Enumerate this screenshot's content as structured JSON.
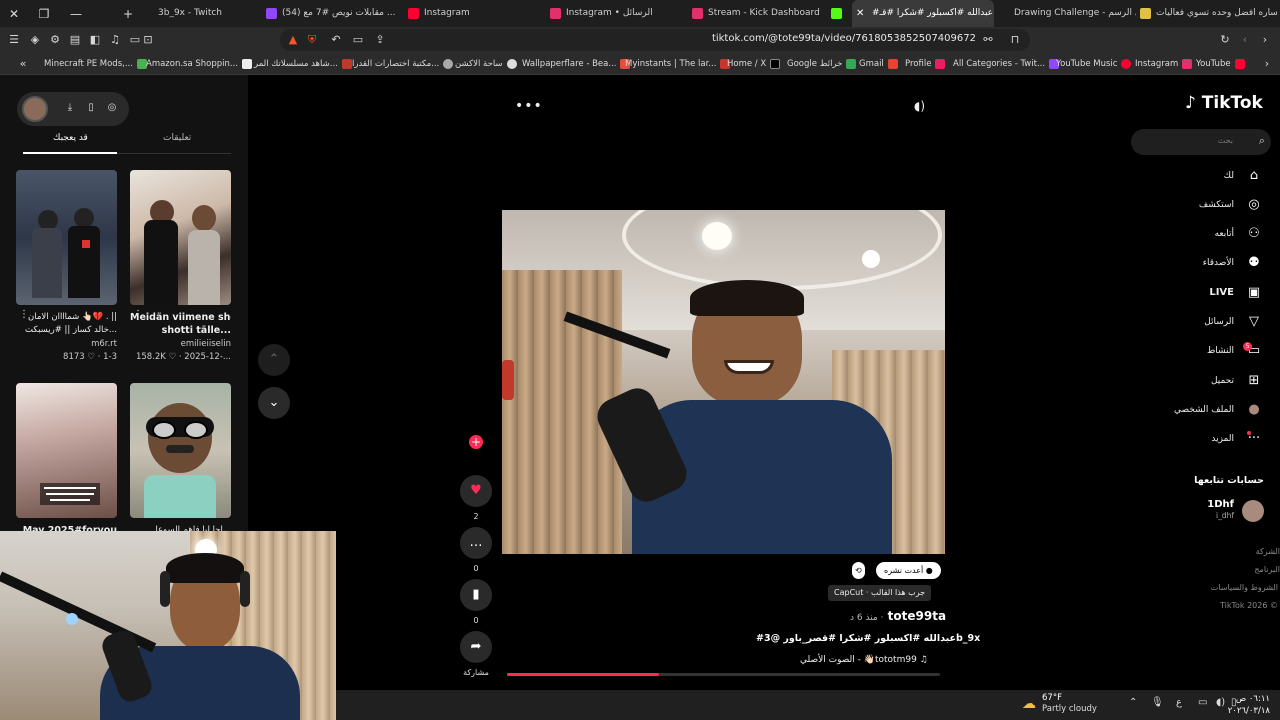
{
  "browser": {
    "tabs": [
      {
        "label": "3b_9x - Twitch",
        "color": "#9146ff"
      },
      {
        "label": "(54) مقابلات نويص #7 مع ...",
        "color": "#9146ff"
      },
      {
        "label": "Instagram",
        "color": "#ff0033"
      },
      {
        "label": "Instagram • الرسائل",
        "color": "#e1306c"
      },
      {
        "label": "Stream - Kick Dashboard",
        "color": "#e1306c"
      },
      {
        "label": "#عبدالله #اكسبلور #شكرا #قـ",
        "color": "#53fc18"
      },
      {
        "label": "Drawing Challenge - تحدي الرسم",
        "color": "#ffffff"
      },
      {
        "label": "ساره افضل وحده تسوي فعاليات",
        "color": "#e0c040"
      }
    ],
    "url": "tiktok.com/@tote99ta/video/7618053852507409672",
    "bookmarks": [
      "Minecraft PE Mods,...",
      "Amazon.sa Shoppin...",
      "شاهد مسلسلاتك المر...",
      "مكتبة اختصارات القدرا...",
      "ساحة الاكشن",
      "Wallpaperflare - Bea...",
      "Myinstants | The lar...",
      "Home / X",
      "Google خرائط",
      "Gmail",
      "Profile",
      "All Categories - Twit...",
      "YouTube Music",
      "Instagram",
      "YouTube"
    ]
  },
  "left_panel": {
    "tabs": {
      "liked": "قد يعجبك",
      "comments": "تعليقات"
    },
    "cards": [
      {
        "title": "Meidän viimene shotti tälle",
        "title2": "shotti tälle...",
        "author": "emilieiiselin",
        "meta": "158.2K ♡ · 2025-12-...",
        "bold": true
      },
      {
        "title": "شماااان الامان 👆🏻💔 . ||",
        "title2": "خالد كساز || #ريسبكت...",
        "author": "m6r.rt",
        "meta": "8173 ♡ · 1-3",
        "bold": false
      },
      {
        "title": "احا ليا فاهم السوعا...",
        "title2": "",
        "author": "",
        "meta": "",
        "bold": false
      },
      {
        "title": "May 2025#foryou",
        "title2": "",
        "author": "",
        "meta": "",
        "bold": true
      }
    ]
  },
  "video": {
    "likes": "2",
    "comments": "0",
    "saves": "0",
    "share_label": "مشاركة",
    "repost_chip": "أعدت نشره",
    "capcut_chip": "CapCut · جرب هذا القالب",
    "author": "tote99ta",
    "ago": "منذ 6 د ·",
    "description": "#عبدالله #اكسبلور #شكرا #قصر_باور @3b_9x",
    "music": "الصوت الأصلي - 👋🏻tototm99",
    "progress": 0.35
  },
  "right_nav": {
    "logo": "TikTok",
    "search_placeholder": "بحث",
    "items": [
      {
        "label": "لك",
        "icon": "⌂"
      },
      {
        "label": "استكشف",
        "icon": "◎"
      },
      {
        "label": "أتابعه",
        "icon": "⚇"
      },
      {
        "label": "الأصدقاء",
        "icon": "⚇"
      },
      {
        "label": "LIVE",
        "icon": "▣"
      },
      {
        "label": "الرسائل",
        "icon": "▽"
      },
      {
        "label": "النشاط",
        "icon": "▭"
      },
      {
        "label": "تحميل",
        "icon": "⊞"
      },
      {
        "label": "الملف الشخصي",
        "icon": "●"
      },
      {
        "label": "المزيد",
        "icon": "···"
      }
    ],
    "activity_badge": "5",
    "following_header": "حسابات تتابعها",
    "following": {
      "name": "1Dhf",
      "user": "i_dhf"
    },
    "footer": [
      "الشركة",
      "البرنامج",
      "الشروط والسياسات",
      "TikTok 2026 ©"
    ]
  },
  "taskbar": {
    "temp": "67°F",
    "weather": "Partly cloudy",
    "time": "٠٦:١١ ص",
    "date": "٢٠٢٦/٠٣/١٨",
    "lang": "ع"
  }
}
